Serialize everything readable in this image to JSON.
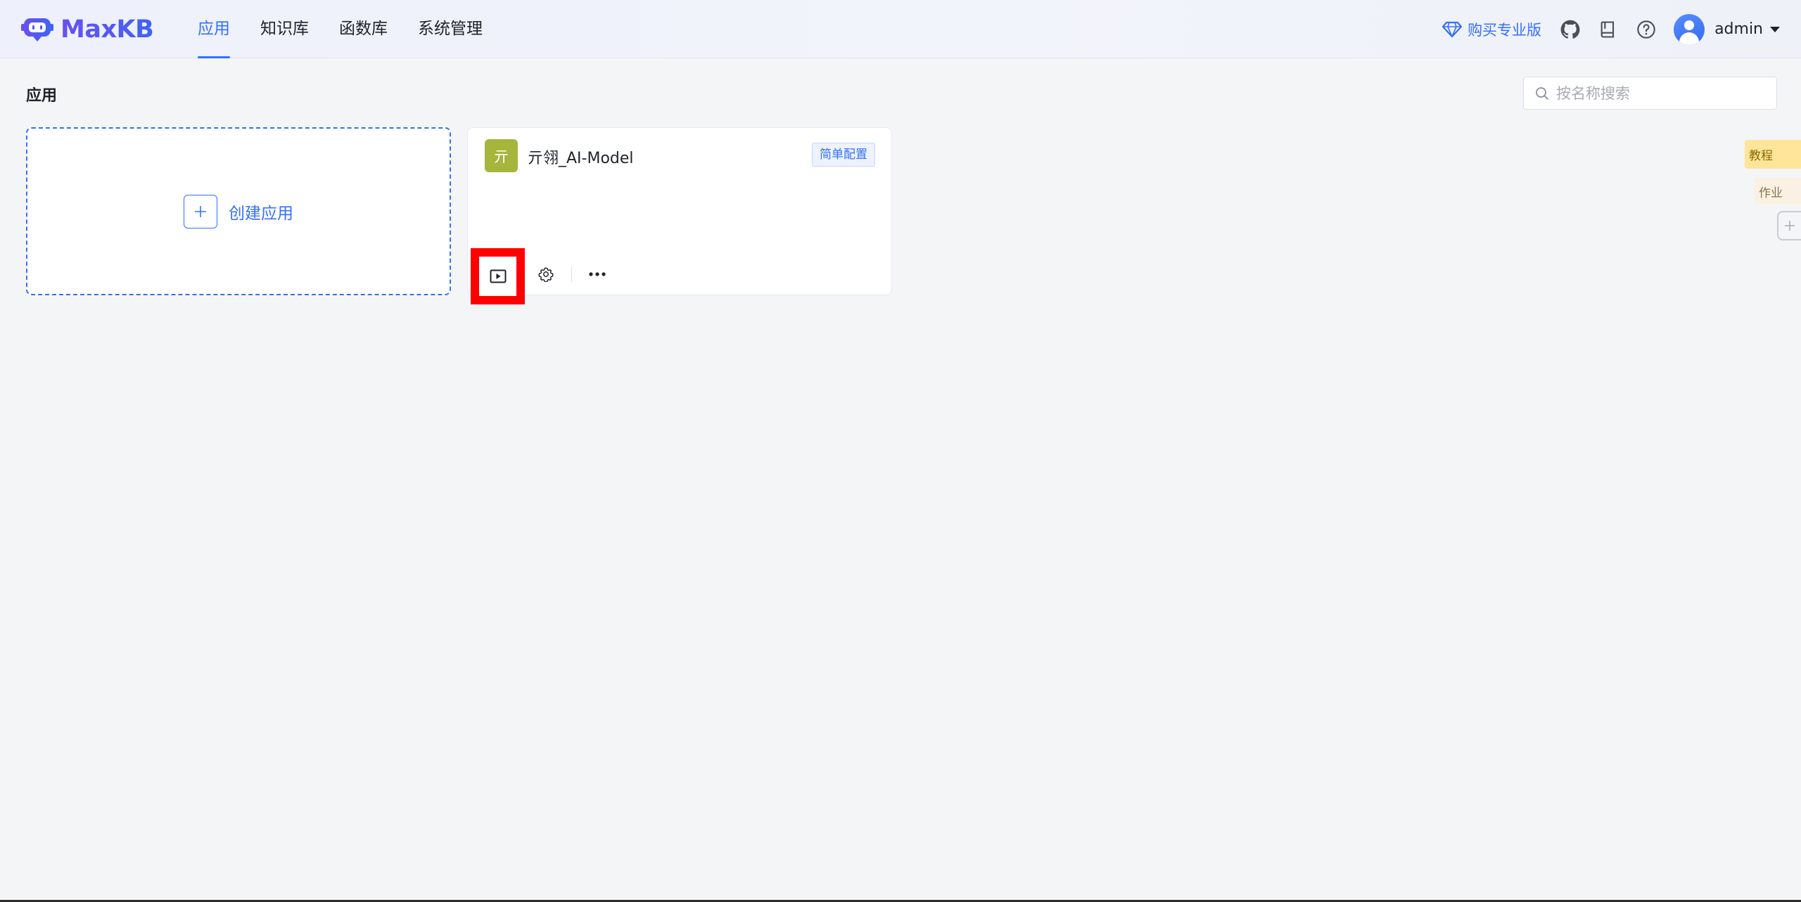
{
  "header": {
    "brand": "MaxKB",
    "nav": [
      {
        "label": "应用",
        "active": true
      },
      {
        "label": "知识库",
        "active": false
      },
      {
        "label": "函数库",
        "active": false
      },
      {
        "label": "系统管理",
        "active": false
      }
    ],
    "upgrade_label": "购买专业版",
    "icons": [
      "github-icon",
      "book-icon",
      "help-icon"
    ],
    "username": "admin"
  },
  "main": {
    "title": "应用",
    "search": {
      "placeholder": "按名称搜索",
      "value": ""
    },
    "create_label": "创建应用",
    "apps": [
      {
        "avatar_char": "亓",
        "name": "亓翎_AI-Model",
        "tag": "简单配置",
        "avatar_color": "#a6b53c"
      }
    ]
  },
  "side_tabs": {
    "tutorial": "教程",
    "homework": "作业"
  },
  "colors": {
    "accent": "#3370ff",
    "highlight": "#ff0000"
  }
}
